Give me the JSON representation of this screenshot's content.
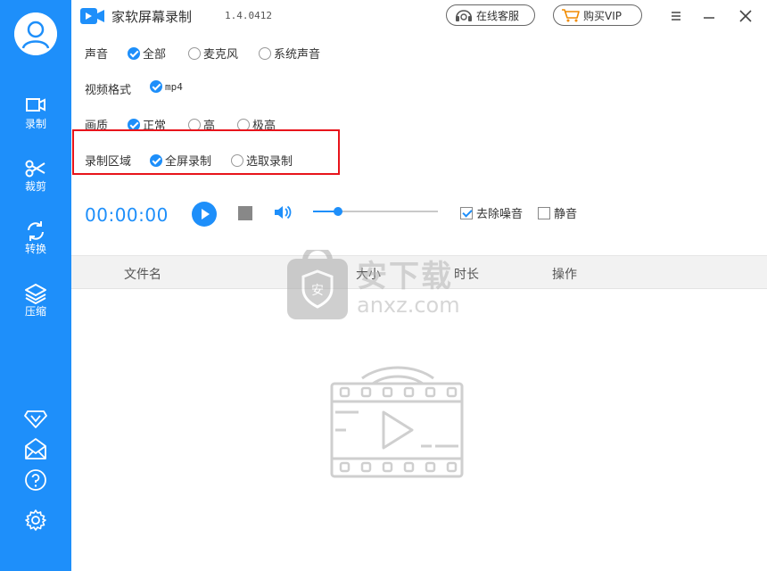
{
  "app": {
    "title": "家软屏幕录制",
    "version": "1.4.0412",
    "online_service_label": "在线客服",
    "buy_vip_label": "购买VIP"
  },
  "sidebar": {
    "items": [
      {
        "label": "录制",
        "icon": "video-camera-icon"
      },
      {
        "label": "裁剪",
        "icon": "scissors-icon"
      },
      {
        "label": "转换",
        "icon": "convert-icon"
      },
      {
        "label": "压缩",
        "icon": "layers-icon"
      }
    ],
    "bottom_icons": [
      "vip-diamond-icon",
      "mail-icon",
      "help-icon",
      "gear-icon"
    ]
  },
  "settings": {
    "audio": {
      "label": "声音",
      "options": [
        {
          "label": "全部",
          "selected": true
        },
        {
          "label": "麦克风",
          "selected": false
        },
        {
          "label": "系统声音",
          "selected": false
        }
      ]
    },
    "format": {
      "label": "视频格式",
      "options": [
        {
          "label": "mp4",
          "selected": true
        }
      ]
    },
    "quality": {
      "label": "画质",
      "options": [
        {
          "label": "正常",
          "selected": true
        },
        {
          "label": "高",
          "selected": false
        },
        {
          "label": "极高",
          "selected": false
        }
      ]
    },
    "region": {
      "label": "录制区域",
      "options": [
        {
          "label": "全屏录制",
          "selected": true
        },
        {
          "label": "选取录制",
          "selected": false
        }
      ]
    }
  },
  "controls": {
    "timer": "00:00:00",
    "volume_fraction": 0.2,
    "denoise": {
      "label": "去除噪音",
      "checked": true
    },
    "mute": {
      "label": "静音",
      "checked": false
    }
  },
  "table": {
    "columns": [
      "文件名",
      "大小",
      "时长",
      "操作"
    ]
  },
  "watermark": {
    "text_cn": "安下载",
    "text_en": "anxz.com"
  },
  "colors": {
    "accent": "#1e8ffa",
    "highlight_border": "#e8141b",
    "header_bg": "#f2f2f2"
  }
}
